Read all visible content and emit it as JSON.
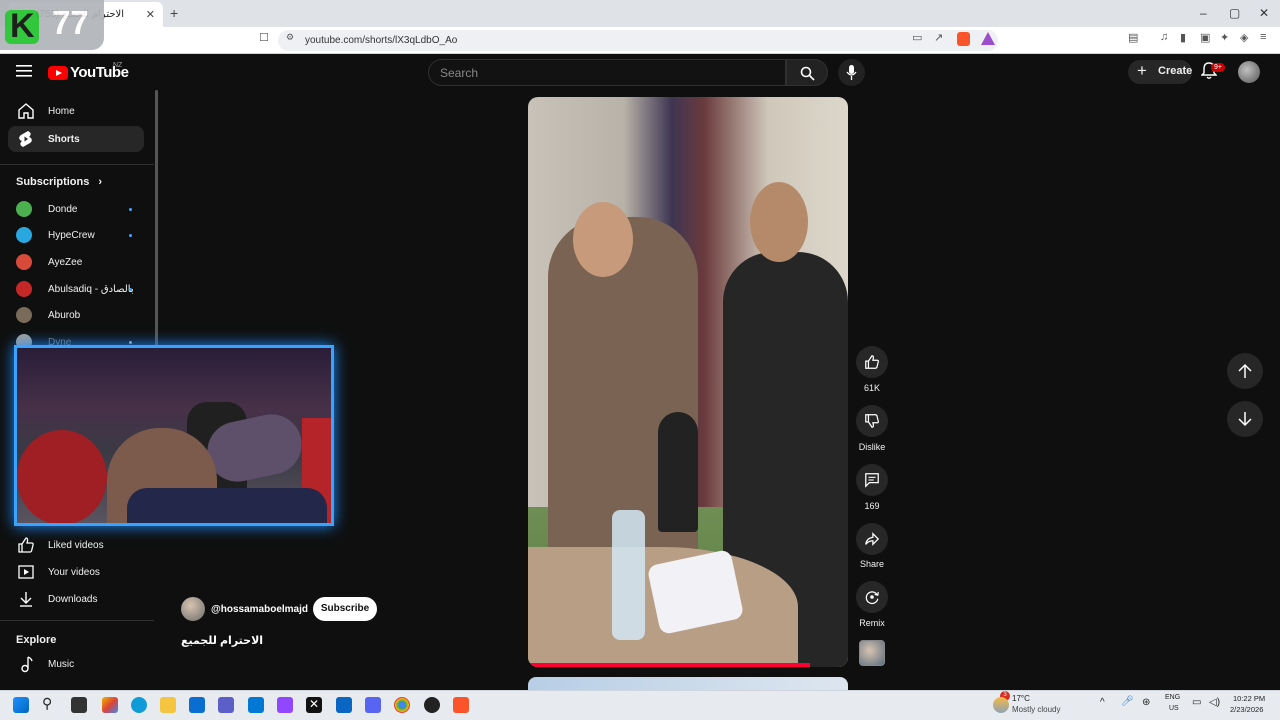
{
  "browser": {
    "tab_title": "(753) الاحترام للجميع",
    "new_tab_symbol": "+",
    "url": "youtube.com/shorts/lX3qLdbO_Ao",
    "window_controls": [
      "–",
      "▢",
      "✕"
    ]
  },
  "overlay": {
    "logo_letter": "K",
    "logo_number": "77"
  },
  "header": {
    "logo_text": "YouTube",
    "region": "NZ",
    "search_placeholder": "Search",
    "create_label": "Create",
    "notifications_badge": "9+"
  },
  "sidebar": {
    "main": [
      {
        "label": "Home",
        "icon": "home-icon",
        "active": false
      },
      {
        "label": "Shorts",
        "icon": "shorts-icon",
        "active": true
      }
    ],
    "subscriptions_heading": "Subscriptions",
    "subscriptions": [
      {
        "label": "Donde",
        "color": "#4caf50"
      },
      {
        "label": "HypeCrew",
        "color": "#29a8e0"
      },
      {
        "label": "AyeZee",
        "color": "#d84a3a"
      },
      {
        "label": "Abulsadiq - بالصادق",
        "color": "#c62828"
      },
      {
        "label": "Aburob",
        "color": "#7a6a5a"
      },
      {
        "label": "Dyne",
        "color": "#9e9e9e"
      }
    ],
    "you_items": [
      {
        "label": "Liked videos",
        "icon": "thumbs-up-icon"
      },
      {
        "label": "Your videos",
        "icon": "play-box-icon"
      },
      {
        "label": "Downloads",
        "icon": "download-icon"
      }
    ],
    "explore_heading": "Explore",
    "explore_items": [
      {
        "label": "Music",
        "icon": "music-note-icon"
      }
    ]
  },
  "short": {
    "channel_handle": "@hossamaboelmajd",
    "subscribe_label": "Subscribe",
    "title": "الاحترام للجميع",
    "progress_fraction": 0.88
  },
  "actions": {
    "like_count": "61K",
    "dislike_label": "Dislike",
    "comment_count": "169",
    "share_label": "Share",
    "remix_label": "Remix"
  },
  "taskbar": {
    "weather_temp": "17°C",
    "weather_desc": "Mostly cloudy",
    "weather_badge": "3",
    "lang_line1": "ENG",
    "lang_line2": "US",
    "time": "10:22 PM",
    "date": "2/23/2026"
  },
  "colors": {
    "youtube_red": "#ff0000",
    "progress_red": "#ff0033",
    "webcam_glow": "#3aa3ff",
    "overlay_green": "#22c32e"
  }
}
